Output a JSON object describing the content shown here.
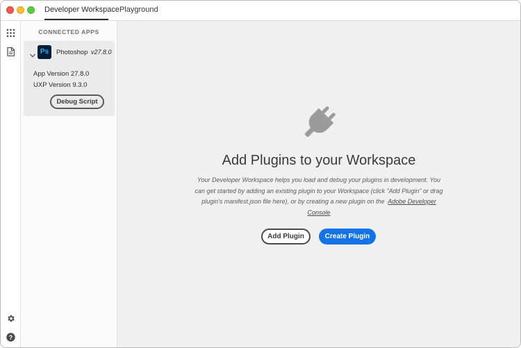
{
  "window": {
    "tabs": [
      {
        "label": "Developer Workspace",
        "active": true
      },
      {
        "label": "Playground",
        "active": false
      }
    ]
  },
  "rail": {
    "icons": [
      "apps-grid-icon",
      "document-icon",
      "gear-icon",
      "help-icon"
    ]
  },
  "sidebar": {
    "header": "CONNECTED APPS",
    "app": {
      "logo_text": "Ps",
      "name": "Photoshop",
      "version": "v27.8.0",
      "app_version": "App Version 27.8.0",
      "uxp_version": "UXP Version 9.3.0",
      "debug_label": "Debug Script"
    }
  },
  "main": {
    "title": "Add Plugins to your Workspace",
    "desc_text": "Your Developer Workspace helps you load and debug your plugins in development. You can get started by adding an existing plugin to your Workspace (click \"Add Plugin\" or drag plugin's manifest.json file here), or by creating a new plugin on the",
    "desc_link": "Adobe Developer Console",
    "add_plugin_label": "Add Plugin",
    "create_plugin_label": "Create Plugin",
    "icon": "plug-icon"
  },
  "colors": {
    "accent": "#1473e6",
    "ps_bg": "#001e36",
    "ps_fg": "#31a8ff"
  }
}
